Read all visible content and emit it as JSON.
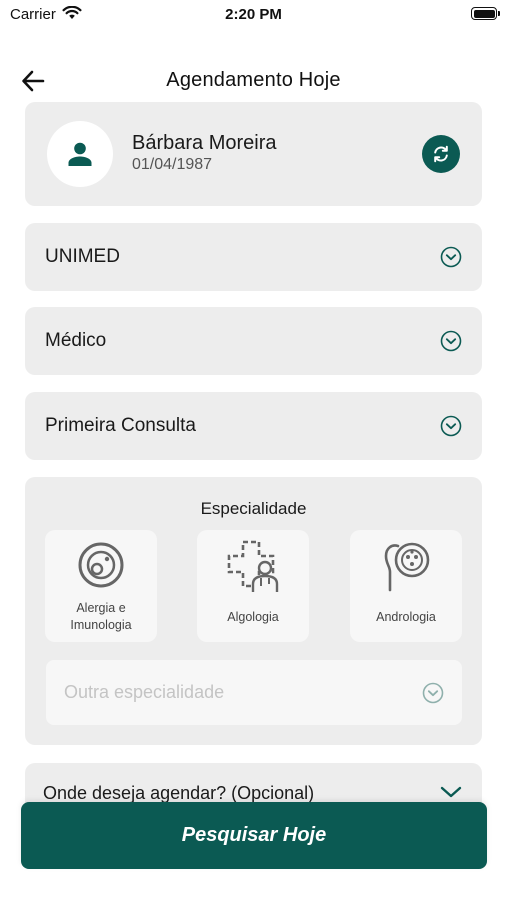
{
  "status_bar": {
    "carrier": "Carrier",
    "time": "2:20 PM"
  },
  "header": {
    "title": "Agendamento Hoje",
    "back_icon": "arrow-left-icon"
  },
  "patient": {
    "name": "Bárbara Moreira",
    "birth_date": "01/04/1987",
    "avatar_icon": "person-icon",
    "refresh_icon": "refresh-icon"
  },
  "selects": {
    "insurance": "UNIMED",
    "professional_type": "Médico",
    "consultation_type": "Primeira Consulta"
  },
  "specialty": {
    "title": "Especialidade",
    "tiles": [
      {
        "label": "Alergia e Imunologia",
        "icon": "allergy-cell-icon"
      },
      {
        "label": "Algologia",
        "icon": "medical-cross-doctor-icon"
      },
      {
        "label": "Andrologia",
        "icon": "andrology-icon"
      }
    ],
    "other_placeholder": "Outra especialidade"
  },
  "location": {
    "label": "Onde deseja agendar? (Opcional)"
  },
  "actions": {
    "search_label": "Pesquisar Hoje"
  },
  "colors": {
    "primary": "#0b5a53",
    "card_bg": "#ededed",
    "tile_bg": "#f7f7f7"
  }
}
